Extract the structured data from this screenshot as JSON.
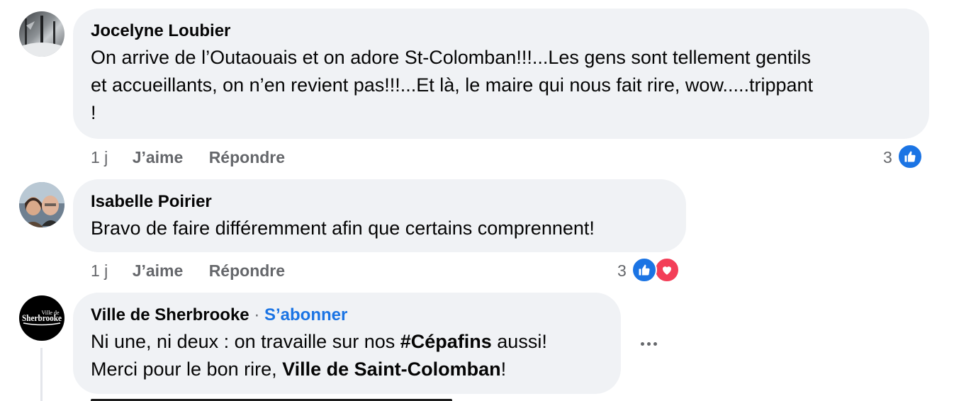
{
  "comments": [
    {
      "author": "Jocelyne Loubier",
      "text_line1": "On arrive de l’Outaouais et on adore St-Colomban!!!...Les gens sont tellement gentils",
      "text_line2": "et accueillants, on n’en revient pas!!!...Et là, le maire qui nous fait rire, wow.....trippant",
      "text_line3": "!",
      "time": "1 j",
      "like_label": "J’aime",
      "reply_label": "Répondre",
      "reaction_count": "3",
      "reactions": [
        "like-icon"
      ]
    },
    {
      "author": "Isabelle Poirier",
      "text_line1": "Bravo de faire différemment afin que certains comprennent!",
      "time": "1 j",
      "like_label": "J’aime",
      "reply_label": "Répondre",
      "reaction_count": "3",
      "reactions": [
        "like-icon",
        "love-icon"
      ]
    },
    {
      "author": "Ville de Sherbrooke",
      "separator": "·",
      "follow_label": "S’abonner",
      "avatar_text_top": "Ville de",
      "avatar_text_main": "Sherbrooke",
      "line1_before": "Ni une, ni deux : on travaille sur nos ",
      "line1_bold": "#Cépafins",
      "line1_after": " aussi!",
      "line2_before": "Merci pour le bon rire, ",
      "line2_bold": "Ville de Saint-Colomban",
      "line2_after": "!",
      "more_icon": "ellipsis-icon"
    }
  ],
  "colors": {
    "bubble": "#f0f2f5",
    "meta": "#65676b",
    "link": "#1b74e4",
    "like": "#1b74e4",
    "love": "#f33e58"
  }
}
